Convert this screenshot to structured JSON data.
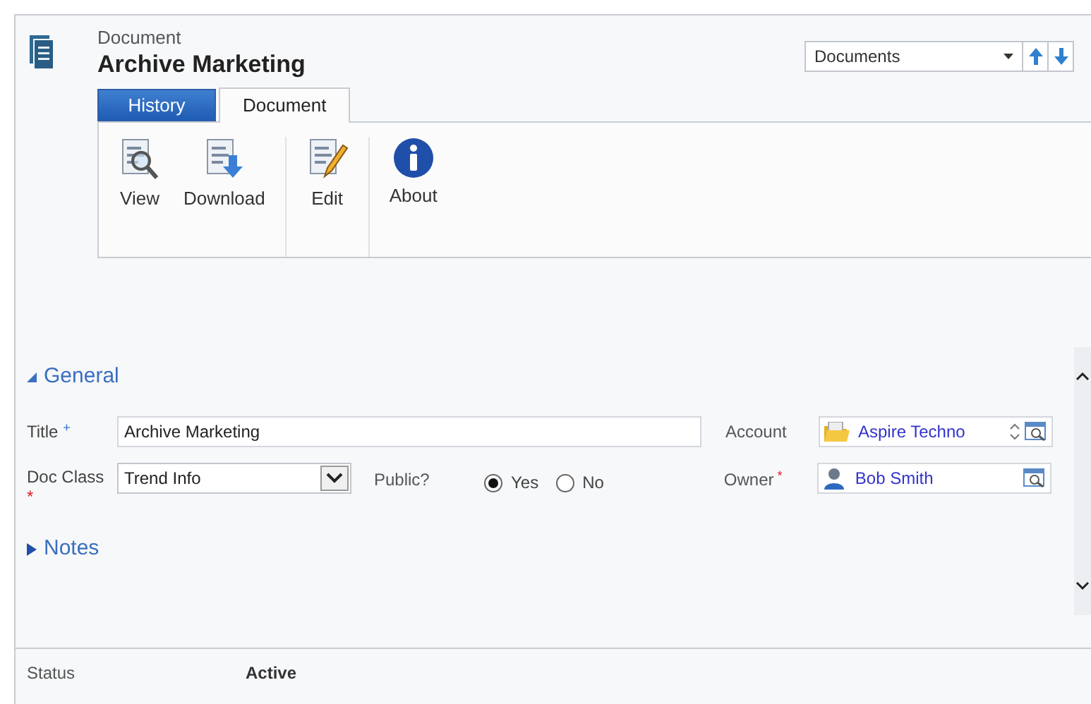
{
  "header": {
    "entity": "Document",
    "title": "Archive Marketing"
  },
  "navigator": {
    "value": "Documents"
  },
  "tabs": [
    {
      "label": "History",
      "selected": false
    },
    {
      "label": "Document",
      "selected": true
    }
  ],
  "ribbon_groups": [
    {
      "buttons": [
        {
          "label": "View",
          "kind": "view"
        },
        {
          "label": "Download",
          "kind": "download"
        }
      ]
    },
    {
      "buttons": [
        {
          "label": "Edit",
          "kind": "edit"
        }
      ]
    },
    {
      "buttons": [
        {
          "label": "About",
          "kind": "about"
        }
      ]
    }
  ],
  "sections": [
    {
      "title": "General",
      "expanded": true
    },
    {
      "title": "Notes",
      "expanded": false
    }
  ],
  "fields": {
    "title": {
      "label": "Title",
      "marker": "+",
      "required": false,
      "value": "Archive Marketing"
    },
    "doc_class": {
      "label": "Doc Class",
      "marker": "*",
      "required": true,
      "value": "Trend Info"
    },
    "public": {
      "label": "Public?",
      "options": [
        {
          "label": "Yes",
          "selected": true
        },
        {
          "label": "No",
          "selected": false
        }
      ]
    },
    "account": {
      "label": "Account",
      "value": "Aspire Techno"
    },
    "owner": {
      "label": "Owner",
      "marker": "*",
      "required": true,
      "value": "Bob Smith"
    }
  },
  "status_bar": {
    "label": "Status",
    "value": "Active"
  }
}
